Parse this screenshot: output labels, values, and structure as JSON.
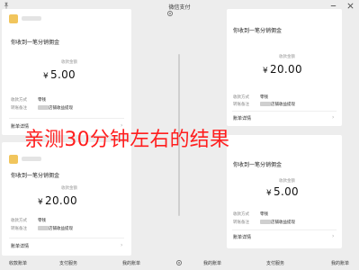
{
  "window": {
    "title": "微信支付",
    "icons": [
      "pin-icon",
      "settings-icon",
      "minimize-icon",
      "close-icon"
    ]
  },
  "cards": [
    {
      "notice": "你收到一笔分销佣金",
      "amount_label": "收款金额",
      "currency": "¥",
      "amount": "5.00",
      "method_label": "收款方式",
      "method_value": "零钱",
      "remark_label": "转账备注",
      "remark_value": "店铺收益提现",
      "details_label": "账单详情"
    },
    {
      "notice": "你收到一笔分销佣金",
      "amount_label": "收款金额",
      "currency": "¥",
      "amount": "20.00",
      "method_label": "收款方式",
      "method_value": "零钱",
      "remark_label": "转账备注",
      "remark_value": "店铺收益提现",
      "details_label": "账单详情"
    },
    {
      "notice": "你收到一笔分销佣金",
      "amount_label": "收款金额",
      "currency": "¥",
      "amount": "20.00",
      "method_label": "收款方式",
      "method_value": "零钱",
      "remark_label": "转账备注",
      "remark_value": "店铺收益提现",
      "details_label": "账单详情"
    },
    {
      "notice": "你收到一笔分销佣金",
      "amount_label": "收款金额",
      "currency": "¥",
      "amount": "5.00",
      "method_label": "收款方式",
      "method_value": "零钱",
      "remark_label": "转账备注",
      "remark_value": "店铺收益提现",
      "details_label": "账单详情"
    }
  ],
  "overlay_text": "亲测30分钟左右的结果",
  "bottom_tabs": [
    "收款账单",
    "支付服务",
    "我的账单",
    "我的账单",
    "支付服务",
    "我的账单"
  ],
  "colors": {
    "background": "#ededed",
    "card": "#ffffff",
    "overlay": "#ff1e1e",
    "avatar": "#f1c55c"
  }
}
